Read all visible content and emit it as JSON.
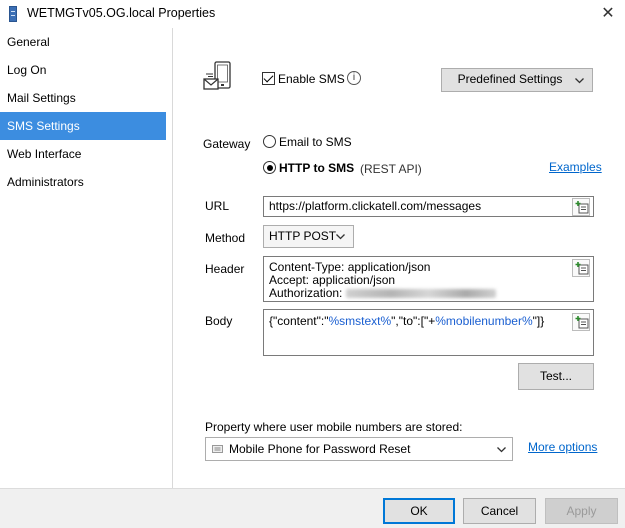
{
  "window": {
    "title": "WETMGTv05.OG.local Properties",
    "close_glyph": "✕"
  },
  "sidebar": {
    "items": [
      {
        "label": "General",
        "active": false
      },
      {
        "label": "Log On",
        "active": false
      },
      {
        "label": "Mail Settings",
        "active": false
      },
      {
        "label": "SMS Settings",
        "active": true
      },
      {
        "label": "Web Interface",
        "active": false
      },
      {
        "label": "Administrators",
        "active": false
      }
    ]
  },
  "sms": {
    "enable_label": "Enable SMS",
    "enable_checked": true,
    "info_glyph": "i",
    "predefined_label": "Predefined Settings",
    "gateway_label": "Gateway",
    "email_option": "Email to SMS",
    "http_option": "HTTP to SMS",
    "http_note": "(REST API)",
    "examples_link": "Examples",
    "url_label": "URL",
    "url_value": "https://platform.clickatell.com/messages",
    "method_label": "Method",
    "method_value": "HTTP POST",
    "header_label": "Header",
    "header_lines": [
      "Content-Type: application/json",
      "Accept: application/json",
      "Authorization:"
    ],
    "body_label": "Body",
    "body_parts": [
      "{\"content\":\"",
      "%smstext%",
      "\",\"to\":[\"+",
      "%mobilenumber%",
      "\"]}"
    ],
    "test_button": "Test...",
    "property_label": "Property where user mobile numbers are stored:",
    "property_value": "Mobile Phone for Password Reset",
    "more_options_link": "More options"
  },
  "footer": {
    "ok": "OK",
    "cancel": "Cancel",
    "apply": "Apply"
  },
  "colors": {
    "accent": "#3c8de0",
    "link": "#0066cc",
    "default_button_border": "#0078d7"
  }
}
